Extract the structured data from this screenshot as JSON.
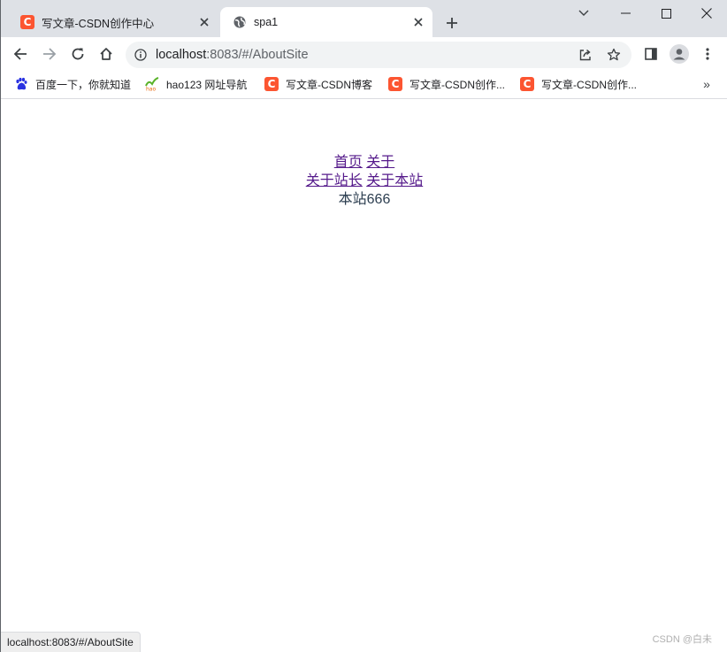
{
  "browser": {
    "tabs": [
      {
        "title": "写文章-CSDN创作中心",
        "favicon": "csdn-icon",
        "active": false
      },
      {
        "title": "spa1",
        "favicon": "globe-icon",
        "active": true
      }
    ],
    "address": {
      "host": "localhost",
      "path": ":8083/#/AboutSite"
    },
    "bookmarks": [
      {
        "label": "百度一下，你就知道",
        "icon": "baidu-paw-icon"
      },
      {
        "label": "hao123 网址导航",
        "icon": "hao123-icon"
      },
      {
        "label": "写文章-CSDN博客",
        "icon": "csdn-icon"
      },
      {
        "label": "写文章-CSDN创作...",
        "icon": "csdn-icon"
      },
      {
        "label": "写文章-CSDN创作...",
        "icon": "csdn-icon"
      }
    ],
    "more_bookmarks": "»"
  },
  "page": {
    "nav_top": [
      {
        "label": "首页"
      },
      {
        "label": "关于"
      }
    ],
    "nav_sub": [
      {
        "label": "关于站长"
      },
      {
        "label": "关于本站"
      }
    ],
    "content_text": "本站666"
  },
  "status": {
    "url": "localhost:8083/#/AboutSite"
  },
  "watermark": "CSDN @白未",
  "colors": {
    "csdn": "#fc5531",
    "link": "#551a8b",
    "text": "#2c3e50",
    "tabstrip": "#dee1e6"
  }
}
